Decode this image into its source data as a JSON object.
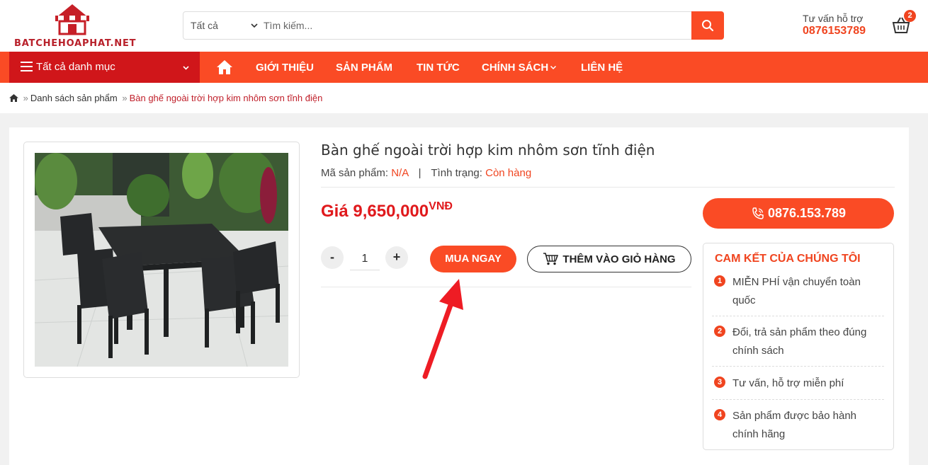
{
  "brand": {
    "name": "BATCHEHOAPHAT.NET",
    "logo_icon": "shop-awning-icon",
    "accent": "#fa4b25",
    "dark_red": "#d0161a"
  },
  "search": {
    "category": "Tất cả",
    "placeholder": "Tìm kiếm..."
  },
  "hotline": {
    "label": "Tư vấn hỗ trợ",
    "number": "0876153789"
  },
  "cart": {
    "count": "2"
  },
  "nav": {
    "category_menu": "Tất cả danh mục",
    "items": [
      "GIỚI THIỆU",
      "SẢN PHẨM",
      "TIN TỨC",
      "CHÍNH SÁCH",
      "LIÊN HỆ"
    ]
  },
  "breadcrumb": {
    "sep": "»",
    "list": "Danh sách sản phẩm",
    "current": "Bàn ghế ngoài trời hợp kim nhôm sơn tĩnh điện"
  },
  "product": {
    "title": "Bàn ghế ngoài trời hợp kim nhôm sơn tĩnh điện",
    "sku_label": "Mã sản phẩm:",
    "sku": "N/A",
    "sep": "|",
    "status_label": "Tình trạng:",
    "status": "Còn hàng",
    "price_label": "Giá",
    "price": "9,650,000",
    "currency": "VNĐ",
    "qty": "1",
    "minus": "-",
    "plus": "+",
    "buy_now": "MUA NGAY",
    "add_to_cart": "THÊM VÀO GIỎ HÀNG",
    "phone": "0876.153.789"
  },
  "commitment": {
    "title": "CAM KẾT CỦA CHÚNG TÔI",
    "items": [
      {
        "num": "1",
        "text": "MIỄN PHÍ vận chuyển toàn quốc"
      },
      {
        "num": "2",
        "text": "Đổi, trả sản phẩm theo đúng chính sách"
      },
      {
        "num": "3",
        "text": "Tư vấn, hỗ trợ miễn phí"
      },
      {
        "num": "4",
        "text": "Sản phẩm được bảo hành chính hãng"
      }
    ]
  }
}
